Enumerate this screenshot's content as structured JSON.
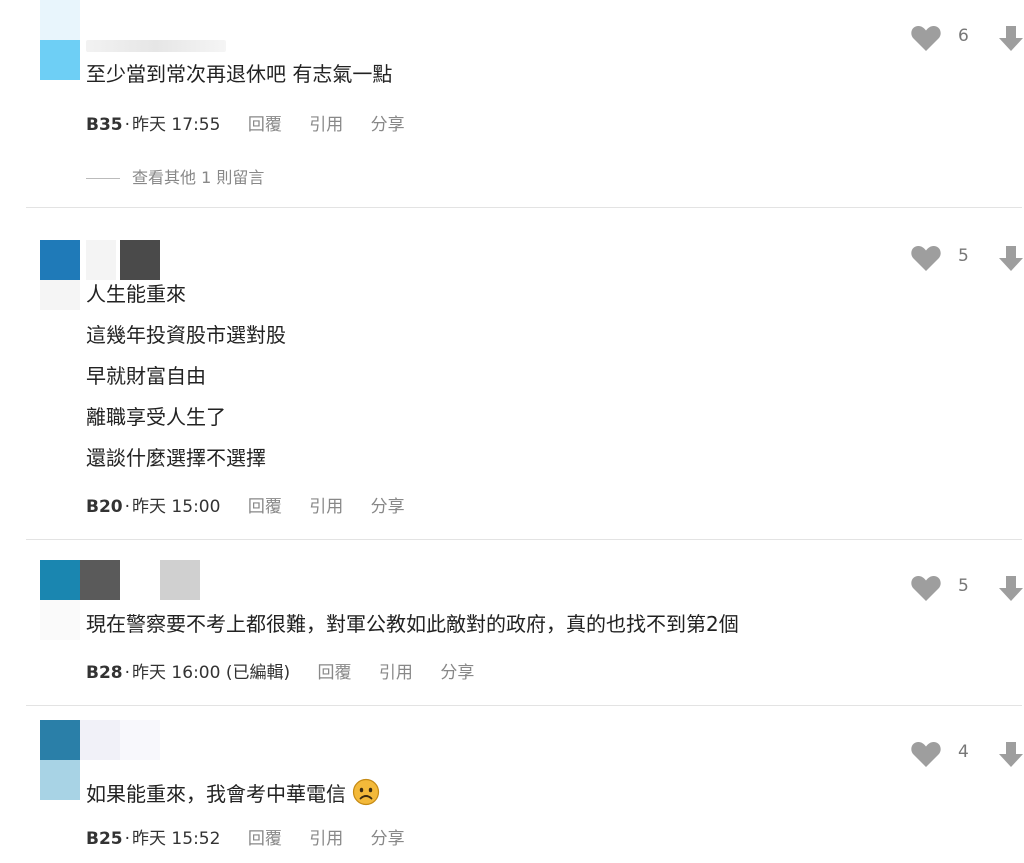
{
  "comments": [
    {
      "lines": [
        "至少當到常次再退休吧 有志氣一點"
      ],
      "floor": "B35",
      "time": "昨天 17:55",
      "likes": "6",
      "more": "查看其他 1 則留言"
    },
    {
      "lines": [
        "人生能重來",
        "這幾年投資股市選對股",
        "早就財富自由",
        "離職享受人生了",
        "還談什麼選擇不選擇"
      ],
      "floor": "B20",
      "time": "昨天 15:00",
      "likes": "5"
    },
    {
      "lines": [
        "現在警察要不考上都很難，對軍公教如此敵對的政府，真的也找不到第2個"
      ],
      "floor": "B28",
      "time": "昨天 16:00 (已編輯)",
      "likes": "5"
    },
    {
      "lines": [
        "如果能重來，我會考中華電信"
      ],
      "floor": "B25",
      "time": "昨天 15:52",
      "likes": "4",
      "emoji": "sad-face-emoji"
    }
  ],
  "actions": {
    "reply": "回覆",
    "quote": "引用",
    "share": "分享"
  },
  "separator": "·",
  "colors": {
    "heart": "#9e9e9e",
    "arrow": "#9e9e9e",
    "action_text": "#888888",
    "divider": "#e3e3e3"
  }
}
